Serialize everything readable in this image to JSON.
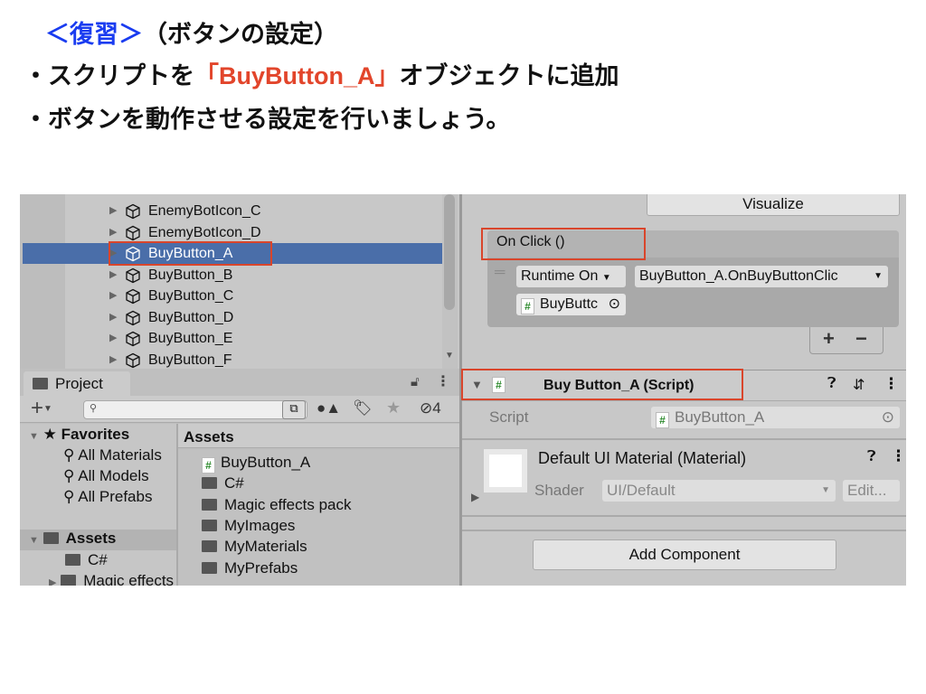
{
  "slide": {
    "heading_accent": "＜復習＞",
    "heading_rest": "（ボタンの設定）",
    "bullet1_pre": "・スクリプトを",
    "bullet1_highlight": "「BuyButton_A」",
    "bullet1_post": "オブジェクトに追加",
    "bullet2": "・ボタンを動作させる設定を行いましょう。",
    "accent_color": "#1a3cf0",
    "highlight_color": "#e2452b"
  },
  "hierarchy": {
    "items": [
      "EnemyBotIcon_C",
      "EnemyBotIcon_D",
      "BuyButton_A",
      "BuyButton_B",
      "BuyButton_C",
      "BuyButton_D",
      "BuyButton_E",
      "BuyButton_F"
    ],
    "selected": "BuyButton_A"
  },
  "project": {
    "tab": "Project",
    "hidden_count": "4",
    "favorites": {
      "label": "Favorites",
      "items": [
        "All Materials",
        "All Models",
        "All Prefabs"
      ]
    },
    "tree": {
      "label": "Assets",
      "items": [
        "C#",
        "Magic effects pack"
      ]
    },
    "assets_header": "Assets",
    "assets": [
      {
        "name": "BuyButton_A",
        "type": "script"
      },
      {
        "name": "C#",
        "type": "folder"
      },
      {
        "name": "Magic effects pack",
        "type": "folder"
      },
      {
        "name": "MyImages",
        "type": "folder"
      },
      {
        "name": "MyMaterials",
        "type": "folder"
      },
      {
        "name": "MyPrefabs",
        "type": "folder"
      }
    ]
  },
  "inspector": {
    "visualize": "Visualize",
    "onclick_label": "On Click ()",
    "runtime": "Runtime On",
    "function": "BuyButton_A.OnBuyButtonClic",
    "object": "BuyButtc",
    "plus": "+",
    "minus": "−",
    "component_title": "Buy Button_A (Script)",
    "script_label": "Script",
    "script_value": "BuyButton_A",
    "material_title": "Default UI Material (Material)",
    "shader_label": "Shader",
    "shader_value": "UI/Default",
    "edit": "Edit...",
    "add_component": "Add Component"
  }
}
